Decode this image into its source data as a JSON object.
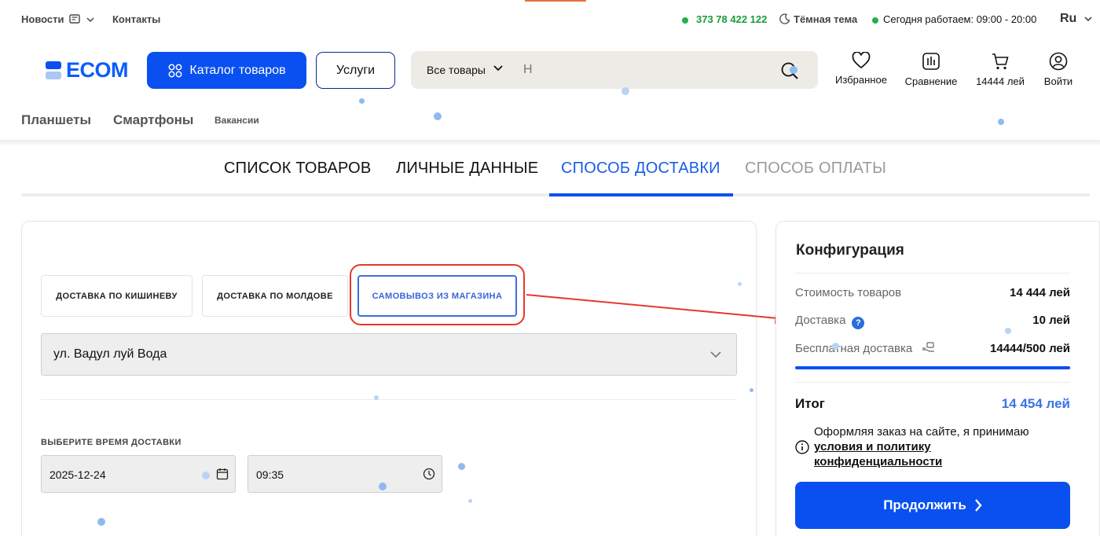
{
  "topbar": {
    "news": "Новости",
    "contacts": "Контакты",
    "phone": "373 78 422 122",
    "dark_theme": "Тёмная тема",
    "hours": "Сегодня работаем: 09:00 - 20:00",
    "language": "Ru"
  },
  "header": {
    "logo_text": "ECOM",
    "catalog_label": "Каталог товаров",
    "services_label": "Услуги",
    "search_scope": "Все товары",
    "search_value": "Н",
    "favorites": "Избранное",
    "compare": "Сравнение",
    "cart": "14444 лей",
    "login": "Войти"
  },
  "subnav": {
    "tablets": "Планшеты",
    "smartphones": "Смартфоны",
    "vacancies": "Вакансии"
  },
  "steps": [
    {
      "label": "СПИСОК ТОВАРОВ",
      "state": "done"
    },
    {
      "label": "ЛИЧНЫЕ ДАННЫЕ",
      "state": "done"
    },
    {
      "label": "СПОСОБ ДОСТАВКИ",
      "state": "active"
    },
    {
      "label": "СПОСОБ ОПЛАТЫ",
      "state": "pending"
    }
  ],
  "delivery": {
    "tabs": [
      {
        "label": "ДОСТАВКА ПО КИШИНЕВУ",
        "active": false
      },
      {
        "label": "ДОСТАВКА ПО МОЛДОВЕ",
        "active": false
      },
      {
        "label": "САМОВЫВОЗ ИЗ МАГАЗИНА",
        "active": true
      }
    ],
    "store_value": "ул. Вадул луй Вода",
    "time_label": "ВЫБЕРИТЕ ВРЕМЯ ДОСТАВКИ",
    "date_value": "2025-12-24",
    "time_value": "09:35"
  },
  "summary": {
    "title": "Конфигурация",
    "goods_label": "Стоимость товаров",
    "goods_value": "14 444 лей",
    "delivery_label": "Доставка",
    "delivery_value": "10 лей",
    "free_delivery_label": "Бесплатная доставка",
    "free_delivery_value": "14444/500 лей",
    "free_delivery_progress": 1.0,
    "total_label": "Итог",
    "total_value": "14 454 лей",
    "terms_text": "Оформляя заказ на сайте, я принимаю",
    "terms_link": "условия и политику конфиденциальности",
    "continue_label": "Продолжить"
  },
  "colors": {
    "brand_blue": "#0a50f0",
    "accent_red": "#e33a2a",
    "status_green": "#22b14c"
  }
}
